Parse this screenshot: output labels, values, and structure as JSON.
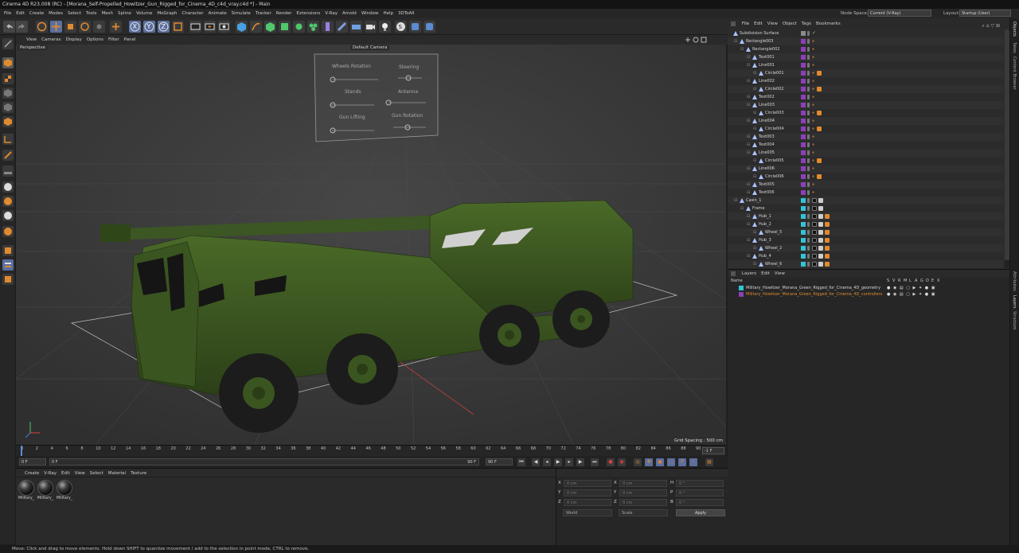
{
  "app": {
    "title": "Cinema 4D R23.008 (RC) - [Morana_Self-Propelled_Howitzer_Gun_Rigged_for_Cinema_4D_c4d_vray.c4d *] - Main"
  },
  "menubar": {
    "items": [
      "File",
      "Edit",
      "Create",
      "Modes",
      "Select",
      "Tools",
      "Mesh",
      "Spline",
      "Volume",
      "MoGraph",
      "Character",
      "Animate",
      "Simulate",
      "Tracker",
      "Render",
      "Extensions",
      "V-Ray",
      "Arnold",
      "Window",
      "Help",
      "3DToAll"
    ],
    "node_space_label": "Node Space:",
    "node_space_value": "Current (V-Ray)",
    "layout_label": "Layout:",
    "layout_value": "Startup (User)"
  },
  "viewport_menu": {
    "items": [
      "View",
      "Cameras",
      "Display",
      "Options",
      "Filter",
      "Panel"
    ]
  },
  "viewport": {
    "label": "Perspective",
    "camera": "Default Camera",
    "grid_spacing": "Grid Spacing : 500 cm",
    "hud_controls": [
      "Wheels Rotation",
      "Steering",
      "Stands",
      "Antenna",
      "Gun Lifting",
      "Gun Rotation"
    ]
  },
  "timeline": {
    "ticks": [
      "0",
      "2",
      "4",
      "6",
      "8",
      "10",
      "12",
      "14",
      "16",
      "18",
      "20",
      "22",
      "24",
      "26",
      "28",
      "30",
      "32",
      "34",
      "36",
      "38",
      "40",
      "42",
      "44",
      "46",
      "48",
      "50",
      "52",
      "54",
      "56",
      "58",
      "60",
      "62",
      "64",
      "66",
      "68",
      "70",
      "72",
      "74",
      "76",
      "78",
      "80",
      "82",
      "84",
      "86",
      "88",
      "90"
    ],
    "current_value": "-1 F"
  },
  "transport": {
    "start_field": "0 F",
    "range_start": "0 F",
    "range_end": "90 F",
    "end_field": "90 F"
  },
  "material_manager": {
    "menu": [
      "Create",
      "V-Ray",
      "Edit",
      "View",
      "Select",
      "Material",
      "Texture"
    ],
    "materials": [
      "Military_",
      "Military_",
      "Military_"
    ]
  },
  "coordinates": {
    "rows": [
      {
        "axis": "X",
        "pos": "0 cm",
        "size_axis": "X",
        "size": "0 cm",
        "rot_axis": "H",
        "rot": "0 °"
      },
      {
        "axis": "Y",
        "pos": "0 cm",
        "size_axis": "Y",
        "size": "0 cm",
        "rot_axis": "P",
        "rot": "0 °"
      },
      {
        "axis": "Z",
        "pos": "0 cm",
        "size_axis": "Z",
        "size": "0 cm",
        "rot_axis": "B",
        "rot": "0 °"
      }
    ],
    "mode": "World",
    "scale_mode": "Scale",
    "apply_label": "Apply"
  },
  "object_manager": {
    "menu": [
      "File",
      "Edit",
      "View",
      "Object",
      "Tags",
      "Bookmarks"
    ],
    "rows": [
      {
        "name": "Subdivision Surface",
        "indent": 0,
        "color": "#8a8a8a",
        "tags": "check"
      },
      {
        "name": "Rectangle003",
        "indent": 1,
        "color": "#8b3fb8",
        "tags": "x"
      },
      {
        "name": "Rectangle002",
        "indent": 2,
        "color": "#8b3fb8",
        "tags": "x"
      },
      {
        "name": "Text001",
        "indent": 3,
        "color": "#8b3fb8",
        "tags": "x"
      },
      {
        "name": "Line001",
        "indent": 3,
        "color": "#8b3fb8",
        "tags": "x"
      },
      {
        "name": "Circle001",
        "indent": 4,
        "color": "#8b3fb8",
        "tags": "xr"
      },
      {
        "name": "Line002",
        "indent": 3,
        "color": "#8b3fb8",
        "tags": "x"
      },
      {
        "name": "Circle002",
        "indent": 4,
        "color": "#8b3fb8",
        "tags": "xr"
      },
      {
        "name": "Text002",
        "indent": 3,
        "color": "#8b3fb8",
        "tags": "x"
      },
      {
        "name": "Line003",
        "indent": 3,
        "color": "#8b3fb8",
        "tags": "x"
      },
      {
        "name": "Circle003",
        "indent": 4,
        "color": "#8b3fb8",
        "tags": "xr"
      },
      {
        "name": "Line004",
        "indent": 3,
        "color": "#8b3fb8",
        "tags": "x"
      },
      {
        "name": "Circle004",
        "indent": 4,
        "color": "#8b3fb8",
        "tags": "xr"
      },
      {
        "name": "Text003",
        "indent": 3,
        "color": "#8b3fb8",
        "tags": "x"
      },
      {
        "name": "Text004",
        "indent": 3,
        "color": "#8b3fb8",
        "tags": "x"
      },
      {
        "name": "Line005",
        "indent": 3,
        "color": "#8b3fb8",
        "tags": "x"
      },
      {
        "name": "Circle005",
        "indent": 4,
        "color": "#8b3fb8",
        "tags": "xr"
      },
      {
        "name": "Line006",
        "indent": 3,
        "color": "#8b3fb8",
        "tags": "x"
      },
      {
        "name": "Circle006",
        "indent": 4,
        "color": "#8b3fb8",
        "tags": "xr"
      },
      {
        "name": "Text005",
        "indent": 3,
        "color": "#8b3fb8",
        "tags": "x"
      },
      {
        "name": "Text006",
        "indent": 3,
        "color": "#8b3fb8",
        "tags": "x"
      },
      {
        "name": "Casin_1",
        "indent": 1,
        "color": "#31c4d4",
        "tags": "m"
      },
      {
        "name": "Frame",
        "indent": 2,
        "color": "#31c4d4",
        "tags": "m"
      },
      {
        "name": "Hub_1",
        "indent": 3,
        "color": "#31c4d4",
        "tags": "mm"
      },
      {
        "name": "Hub_2",
        "indent": 3,
        "color": "#31c4d4",
        "tags": "mm"
      },
      {
        "name": "Wheel_5",
        "indent": 4,
        "color": "#31c4d4",
        "tags": "mm"
      },
      {
        "name": "Hub_3",
        "indent": 3,
        "color": "#31c4d4",
        "tags": "mm"
      },
      {
        "name": "Wheel_2",
        "indent": 4,
        "color": "#31c4d4",
        "tags": "mm"
      },
      {
        "name": "Hub_4",
        "indent": 3,
        "color": "#31c4d4",
        "tags": "mm"
      },
      {
        "name": "Wheel_6",
        "indent": 4,
        "color": "#31c4d4",
        "tags": "mm"
      }
    ]
  },
  "layer_manager": {
    "menu": [
      "Layers",
      "Edit",
      "View"
    ],
    "header": "Name",
    "columns": [
      "S",
      "V",
      "R",
      "M",
      "L",
      "A",
      "G",
      "D",
      "E",
      "X"
    ],
    "layers": [
      {
        "name": "Military_Howitzer_Morana_Green_Rigged_for_Cinema_4D_geometry",
        "color": "#31c4d4",
        "text_color": "#d6d6d6"
      },
      {
        "name": "Military_Howitzer_Morana_Green_Rigged_for_Cinema_4D_controllers",
        "color": "#8b3fb8",
        "text_color": "#e08a30"
      }
    ]
  },
  "side_tabs": [
    "Objects",
    "Takes",
    "Content Browser",
    "Attributes",
    "Layers",
    "Structure"
  ],
  "status": {
    "text": "Move: Click and drag to move elements. Hold down SHIFT to quantize movement / add to the selection in point mode, CTRL to remove."
  },
  "colors": {
    "accent_orange": "#e08a30",
    "tag_purple": "#8b3fb8",
    "tag_cyan": "#31c4d4",
    "vehicle_green": "#3f5a24"
  }
}
